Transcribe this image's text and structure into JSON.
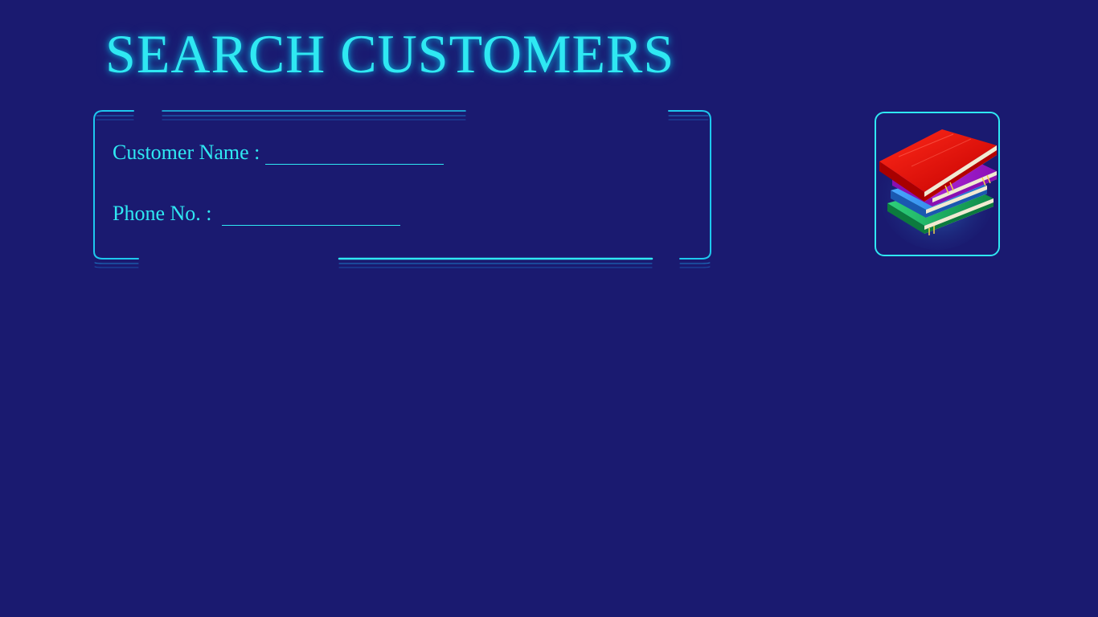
{
  "header": {
    "title": "SEARCH CUSTOMERS"
  },
  "search_form": {
    "customer_name_label": "Customer Name :",
    "customer_name_value": "",
    "phone_label": "Phone No. :",
    "phone_value": ""
  },
  "logo": {
    "icon": "books-stack-icon"
  },
  "colors": {
    "background": "#1a1a70",
    "accent": "#2fe8f2",
    "frame_line": "#1ec8ee"
  }
}
